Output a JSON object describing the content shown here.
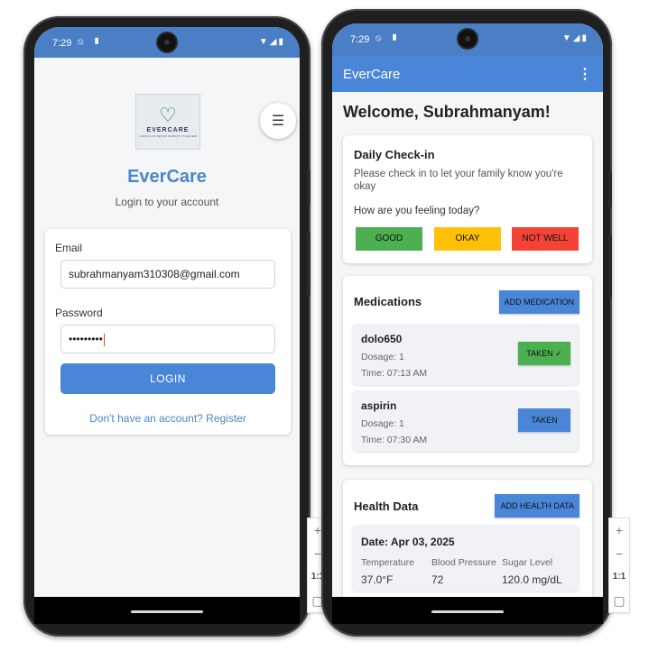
{
  "status_bar": {
    "time": "7:29"
  },
  "login": {
    "logo_text": "EVERCARE",
    "logo_sub": "CARING FOR SENIOR PARENTS, TOGETHER",
    "app_name": "EverCare",
    "subtitle": "Login to your account",
    "email_label": "Email",
    "email_value": "subrahmanyam310308@gmail.com",
    "password_label": "Password",
    "password_value": "•••••••••",
    "login_button": "LOGIN",
    "register_link": "Don't have an account? Register"
  },
  "dashboard": {
    "app_title": "EverCare",
    "welcome": "Welcome, Subrahmanyam!",
    "checkin": {
      "title": "Daily Check-in",
      "description": "Please check in to let your family know you're okay",
      "question": "How are you feeling today?",
      "buttons": [
        {
          "label": "GOOD",
          "color": "#4caf50"
        },
        {
          "label": "OKAY",
          "color": "#ffc107"
        },
        {
          "label": "NOT WELL",
          "color": "#f44336"
        }
      ]
    },
    "medications": {
      "title": "Medications",
      "add_button": "ADD MEDICATION",
      "items": [
        {
          "name": "dolo650",
          "dosage": "Dosage: 1",
          "time": "Time: 07:13 AM",
          "button": "TAKEN ✓",
          "button_color": "#4caf50"
        },
        {
          "name": "aspirin",
          "dosage": "Dosage: 1",
          "time": "Time: 07:30 AM",
          "button": "TAKEN",
          "button_color": "#4a86d8"
        }
      ]
    },
    "health": {
      "title": "Health Data",
      "add_button": "ADD HEALTH DATA",
      "date": "Date: Apr 03, 2025",
      "labels": [
        "Temperature",
        "Blood Pressure",
        "Sugar Level"
      ],
      "values": [
        "37.0°F",
        "72",
        "120.0 mg/dL"
      ]
    }
  },
  "zoom": {
    "plus": "+",
    "minus": "−",
    "ratio": "1:1"
  },
  "colors": {
    "primary": "#4a86d8",
    "status_bar": "#4a7fc6"
  }
}
